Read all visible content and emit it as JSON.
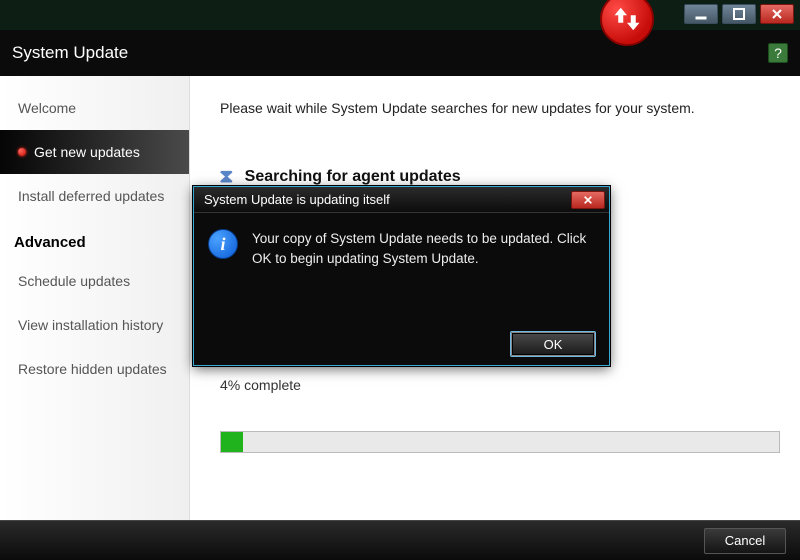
{
  "app": {
    "title": "System Update"
  },
  "window_controls": {
    "min": "minimize",
    "max": "maximize",
    "close": "close"
  },
  "sidebar": {
    "items": [
      {
        "label": "Welcome"
      },
      {
        "label": "Get new updates"
      },
      {
        "label": "Install deferred updates"
      }
    ],
    "advanced_heading": "Advanced",
    "advanced_items": [
      {
        "label": "Schedule updates"
      },
      {
        "label": "View installation history"
      },
      {
        "label": "Restore hidden updates"
      }
    ]
  },
  "main": {
    "intro": "Please wait while System Update searches for new updates for your system.",
    "searching_label": "Searching for agent updates",
    "progress_percent": 4,
    "progress_text": "4% complete"
  },
  "dialog": {
    "title": "System Update is updating itself",
    "message": "Your copy of System Update needs to be updated. Click OK to begin updating System Update.",
    "ok_label": "OK"
  },
  "footer": {
    "cancel_label": "Cancel"
  },
  "colors": {
    "accent_red": "#c70d09",
    "progress_green": "#21b31e",
    "dialog_border": "#3aa6d4"
  }
}
